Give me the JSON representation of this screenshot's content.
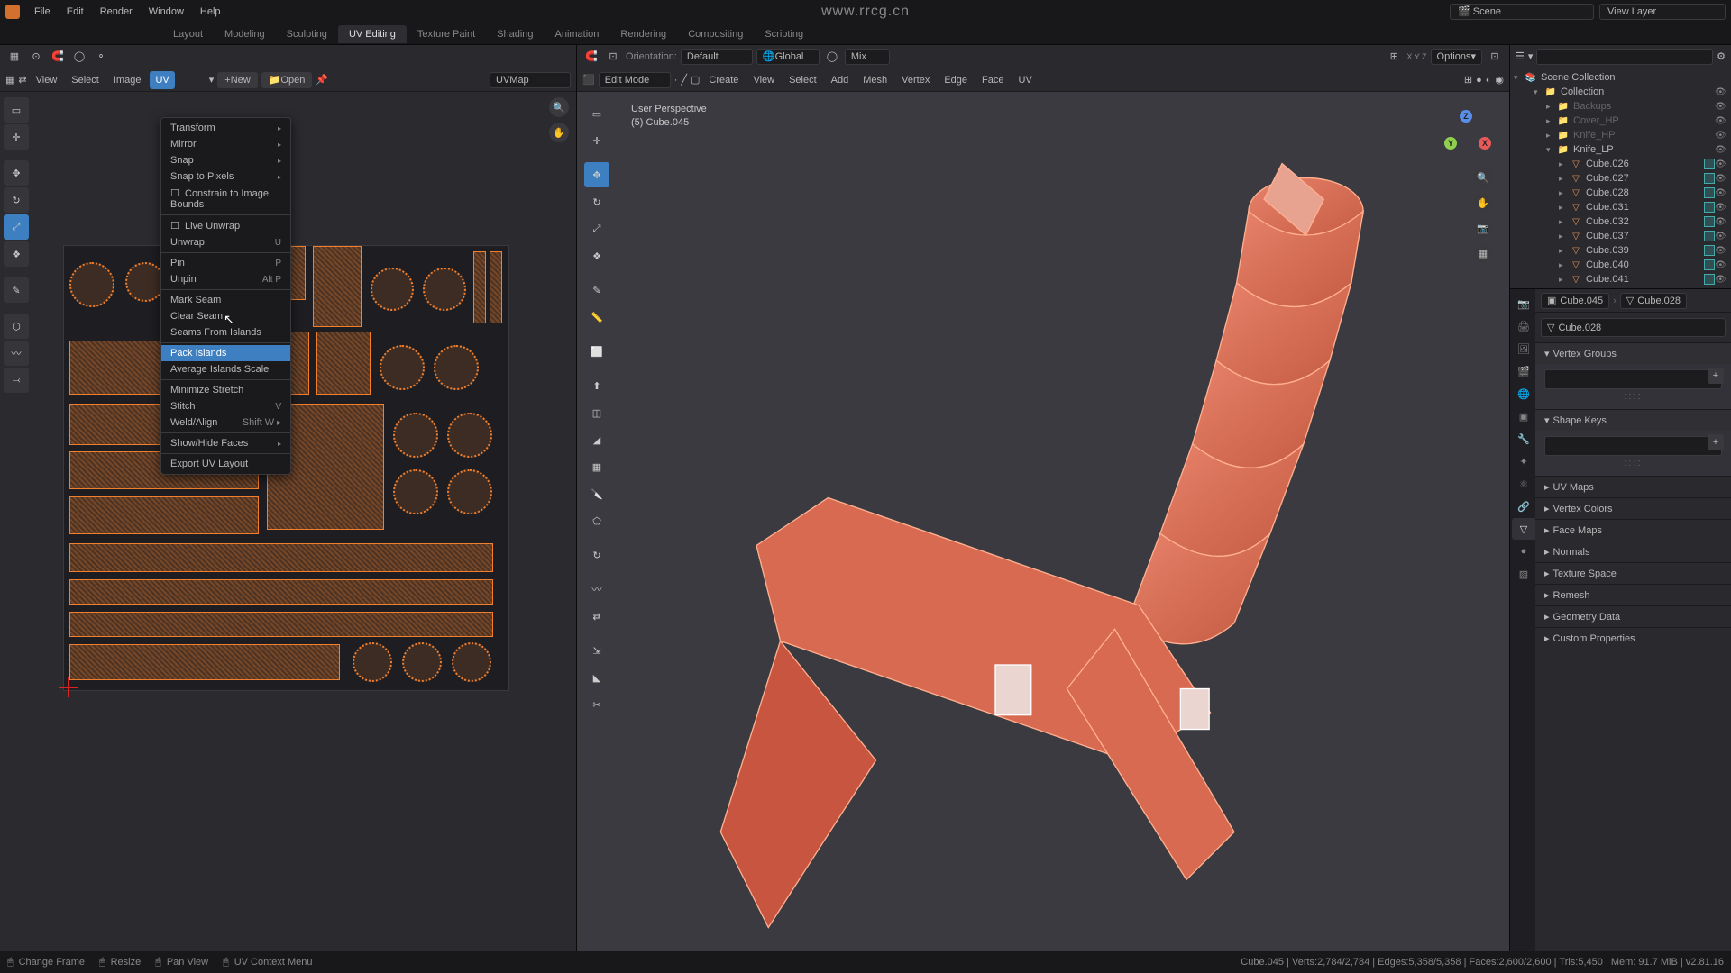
{
  "watermark": "www.rrcg.cn",
  "topbar": {
    "menu": [
      "File",
      "Edit",
      "Render",
      "Window",
      "Help"
    ],
    "scene_label": "Scene",
    "viewlayer_label": "View Layer"
  },
  "workspaces": [
    "Layout",
    "Modeling",
    "Sculpting",
    "UV Editing",
    "Texture Paint",
    "Shading",
    "Animation",
    "Rendering",
    "Compositing",
    "Scripting"
  ],
  "workspace_active": "UV Editing",
  "uv_editor": {
    "sub_menus": [
      "View",
      "Select",
      "Image",
      "UV"
    ],
    "active_menu": "UV",
    "new_btn": "New",
    "open_btn": "Open",
    "uvmap_name": "UVMap",
    "dropdown": {
      "items": [
        {
          "label": "Transform",
          "submenu": true
        },
        {
          "label": "Mirror",
          "submenu": true
        },
        {
          "label": "Snap",
          "submenu": true
        },
        {
          "label": "Snap to Pixels",
          "submenu": true
        },
        {
          "label": "Constrain to Image Bounds",
          "checkbox": true
        },
        {
          "sep": true
        },
        {
          "label": "Live Unwrap",
          "checkbox": true
        },
        {
          "label": "Unwrap",
          "shortcut": "U"
        },
        {
          "sep": true
        },
        {
          "label": "Pin",
          "shortcut": "P"
        },
        {
          "label": "Unpin",
          "shortcut": "Alt P"
        },
        {
          "sep": true
        },
        {
          "label": "Mark Seam"
        },
        {
          "label": "Clear Seam"
        },
        {
          "label": "Seams From Islands"
        },
        {
          "sep": true
        },
        {
          "label": "Pack Islands",
          "highlight": true
        },
        {
          "label": "Average Islands Scale"
        },
        {
          "sep": true
        },
        {
          "label": "Minimize Stretch"
        },
        {
          "label": "Stitch",
          "shortcut": "V"
        },
        {
          "label": "Weld/Align",
          "shortcut": "Shift W",
          "submenu": true
        },
        {
          "sep": true
        },
        {
          "label": "Show/Hide Faces",
          "submenu": true
        },
        {
          "sep": true
        },
        {
          "label": "Export UV Layout"
        }
      ]
    }
  },
  "viewport": {
    "mode": "Edit Mode",
    "header_menus": [
      "View",
      "Select",
      "Add",
      "Mesh",
      "Vertex",
      "Edge",
      "Face",
      "UV"
    ],
    "header_btns": [
      "Create"
    ],
    "orientation_label": "Orientation:",
    "orientation_value": "Default",
    "transform_space": "Global",
    "mix_label": "Mix",
    "options_label": "Options",
    "info_line1": "User Perspective",
    "info_line2": "(5) Cube.045"
  },
  "outliner": {
    "root": "Scene Collection",
    "items": [
      {
        "label": "Collection",
        "type": "coll",
        "depth": 1,
        "expanded": true
      },
      {
        "label": "Backups",
        "type": "coll",
        "depth": 2,
        "greyed": true
      },
      {
        "label": "Cover_HP",
        "type": "coll",
        "depth": 2,
        "greyed": true
      },
      {
        "label": "Knife_HP",
        "type": "coll",
        "depth": 2,
        "greyed": true
      },
      {
        "label": "Knife_LP",
        "type": "coll",
        "depth": 2,
        "expanded": true
      },
      {
        "label": "Cube.026",
        "type": "mesh",
        "depth": 3,
        "rbox": true
      },
      {
        "label": "Cube.027",
        "type": "mesh",
        "depth": 3,
        "rbox": true
      },
      {
        "label": "Cube.028",
        "type": "mesh",
        "depth": 3,
        "rbox": true
      },
      {
        "label": "Cube.031",
        "type": "mesh",
        "depth": 3,
        "rbox": true
      },
      {
        "label": "Cube.032",
        "type": "mesh",
        "depth": 3,
        "rbox": true
      },
      {
        "label": "Cube.037",
        "type": "mesh",
        "depth": 3,
        "rbox": true
      },
      {
        "label": "Cube.039",
        "type": "mesh",
        "depth": 3,
        "rbox": true
      },
      {
        "label": "Cube.040",
        "type": "mesh",
        "depth": 3,
        "rbox": true
      },
      {
        "label": "Cube.041",
        "type": "mesh",
        "depth": 3,
        "rbox": true
      }
    ]
  },
  "properties": {
    "breadcrumb": [
      "Cube.045",
      "Cube.028"
    ],
    "mesh_name": "Cube.028",
    "panels": [
      {
        "title": "Vertex Groups",
        "open": true
      },
      {
        "title": "Shape Keys",
        "open": true
      },
      {
        "title": "UV Maps",
        "open": false
      },
      {
        "title": "Vertex Colors",
        "open": false
      },
      {
        "title": "Face Maps",
        "open": false
      },
      {
        "title": "Normals",
        "open": false
      },
      {
        "title": "Texture Space",
        "open": false
      },
      {
        "title": "Remesh",
        "open": false
      },
      {
        "title": "Geometry Data",
        "open": false
      },
      {
        "title": "Custom Properties",
        "open": false
      }
    ]
  },
  "statusbar": {
    "left": [
      {
        "icon": "mouse",
        "label": "Change Frame"
      },
      {
        "icon": "mouse",
        "label": "Resize"
      },
      {
        "icon": "mouse",
        "label": "Pan View"
      },
      {
        "icon": "mouse",
        "label": "UV Context Menu"
      }
    ],
    "right": "Cube.045 | Verts:2,784/2,784 | Edges:5,358/5,358 | Faces:2,600/2,600 | Tris:5,450 | Mem: 91.7 MiB | v2.81.16"
  }
}
